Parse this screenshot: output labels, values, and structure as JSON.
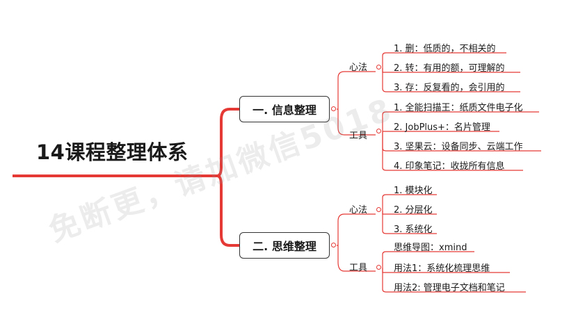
{
  "root": {
    "title": "14课程整理体系"
  },
  "branches": [
    {
      "label": "一. 信息整理",
      "groups": [
        {
          "label": "心法",
          "items": [
            "1. 删：低质的，不相关的",
            "2. 转：有用的额，可理解的",
            "3. 存：反复看的，会引用的"
          ]
        },
        {
          "label": "工具",
          "items": [
            "1. 全能扫描王：纸质文件电子化",
            "2. JobPlus+：名片管理",
            "3. 坚果云：设备同步、云端工作",
            "4. 印象笔记：收拢所有信息"
          ]
        }
      ]
    },
    {
      "label": "二. 思维整理",
      "groups": [
        {
          "label": "心法",
          "items": [
            "1. 模块化",
            "2. 分层化",
            "3. 系统化"
          ]
        },
        {
          "label": "工具",
          "items": [
            "思维导图：xmind",
            "用法1：系统化梳理思维",
            "用法2:  管理电子文档和笔记"
          ]
        }
      ]
    }
  ],
  "watermark": "免断更，请加微信5018",
  "colors": {
    "line": "#e53935",
    "text": "#1a1a1a",
    "box_border": "#333333"
  }
}
